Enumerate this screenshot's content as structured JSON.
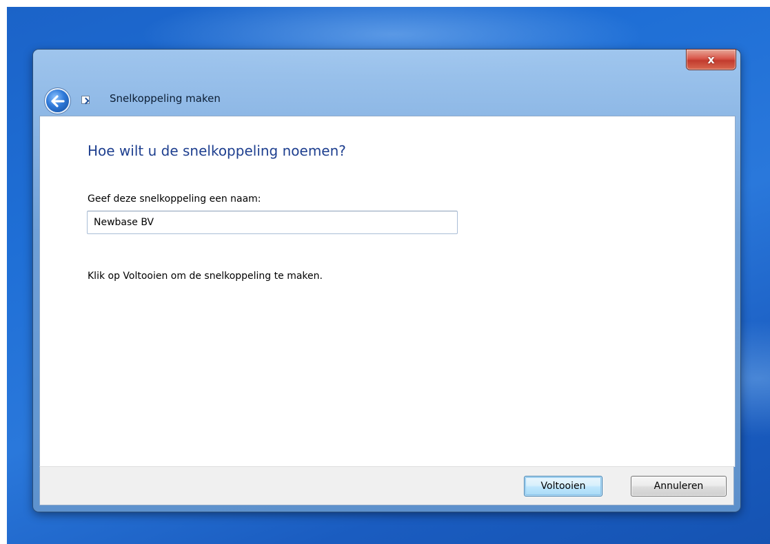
{
  "window": {
    "title": "Snelkoppeling maken",
    "close_glyph": "x"
  },
  "icons": {
    "back": "back-arrow-icon",
    "shortcut": "shortcut-icon",
    "close": "close-icon"
  },
  "content": {
    "heading": "Hoe wilt u de snelkoppeling noemen?",
    "name_label": "Geef deze snelkoppeling een naam:",
    "name_value": "Newbase BV",
    "hint": "Klik op Voltooien om de snelkoppeling te maken."
  },
  "footer": {
    "finish_label": "Voltooien",
    "cancel_label": "Annuleren"
  },
  "colors": {
    "heading": "#1e3f8f",
    "desktop": "#1f6fd6",
    "close_button": "#c23b2e"
  }
}
